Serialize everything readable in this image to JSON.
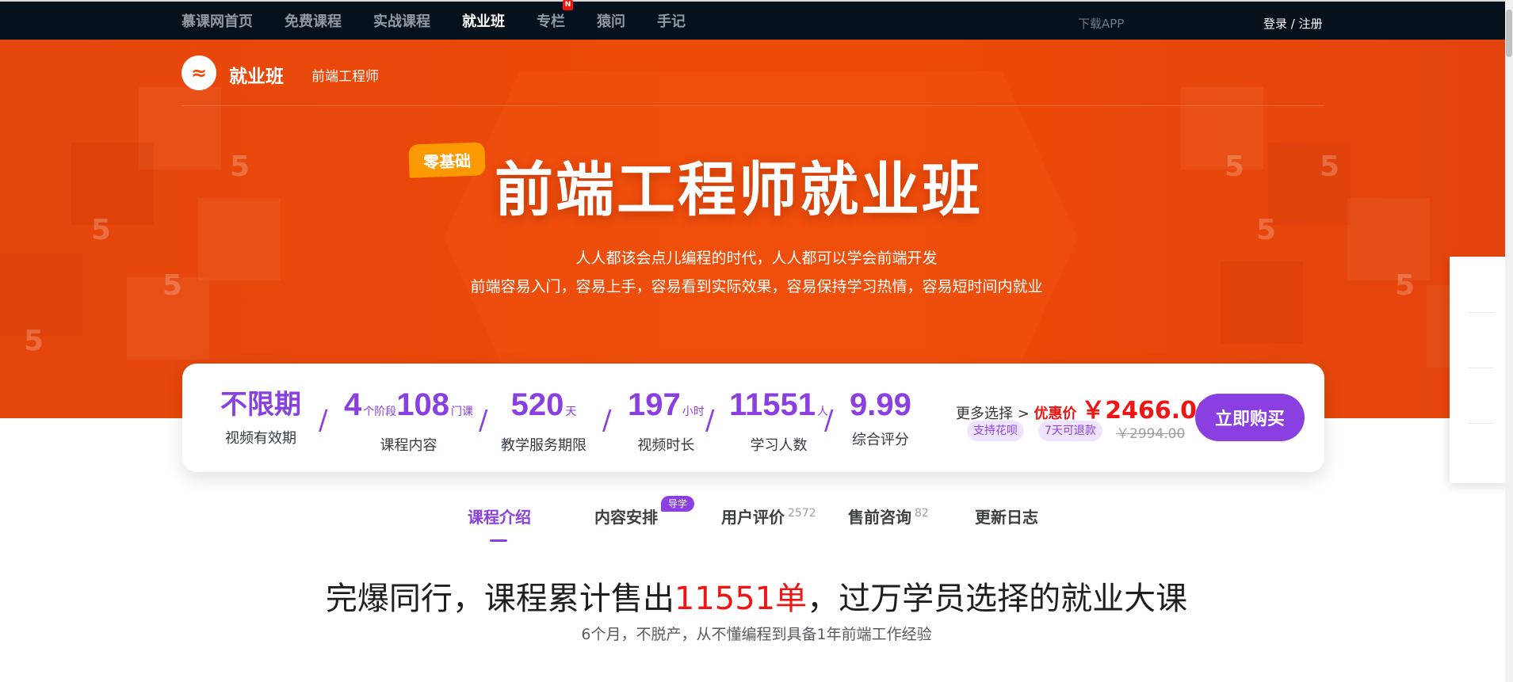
{
  "nav": {
    "items": [
      {
        "label": "慕课网首页",
        "active": false
      },
      {
        "label": "免费课程",
        "active": false
      },
      {
        "label": "实战课程",
        "active": false
      },
      {
        "label": "就业班",
        "active": true
      },
      {
        "label": "专栏",
        "active": false,
        "badge": "N"
      },
      {
        "label": "猿问",
        "active": false
      },
      {
        "label": "手记",
        "active": false
      }
    ],
    "download_app": "下载APP",
    "login": "登录 / 注册"
  },
  "brand": {
    "logo_icon": "imooc-logo-icon",
    "name": "就业班",
    "sub": "前端工程师"
  },
  "hero": {
    "badge": "零基础",
    "title": "前端工程师就业班",
    "line1": "人人都该会点儿编程的时代，人人都可以学会前端开发",
    "line2": "前端容易入门，容易上手，容易看到实际效果，容易保持学习热情，容易短时间内就业",
    "pattern_glyph": "5"
  },
  "stats": {
    "validity": {
      "value": "不限期",
      "label": "视频有效期"
    },
    "content": {
      "stages": "4",
      "stages_unit": "个阶段",
      "courses": "108",
      "courses_unit": "门课",
      "label": "课程内容"
    },
    "service": {
      "value": "520",
      "unit": "天",
      "label": "教学服务期限"
    },
    "duration": {
      "value": "197",
      "unit": "小时",
      "label": "视频时长"
    },
    "students": {
      "value": "11551",
      "unit": "人",
      "label": "学习人数"
    },
    "rating": {
      "value": "9.99",
      "label": "综合评分"
    },
    "separator": "/"
  },
  "pricing": {
    "more_choice": "更多选择 >",
    "promo_label": "优惠价",
    "promo_price": "￥2466.00",
    "tags": [
      "支持花呗",
      "7天可退款"
    ],
    "original_price": "￥2994.00",
    "buy_button": "立即购买"
  },
  "tabs": [
    {
      "label": "课程介绍",
      "active": true
    },
    {
      "label": "内容安排",
      "badge": "导学"
    },
    {
      "label": "用户评价",
      "count": "2572"
    },
    {
      "label": "售前咨询",
      "count": "82"
    },
    {
      "label": "更新日志"
    }
  ],
  "headline": {
    "before": "完爆同行，课程累计售出",
    "highlight": "11551单",
    "after": "，过万学员选择的就业大课",
    "sub": "6个月，不脱产，从不懂编程到具备1年前端工作经验"
  },
  "colors": {
    "accent": "#8a3fe0",
    "hero": "#ee4a08",
    "price_red": "#f01414",
    "nav_bg": "#07111b"
  }
}
